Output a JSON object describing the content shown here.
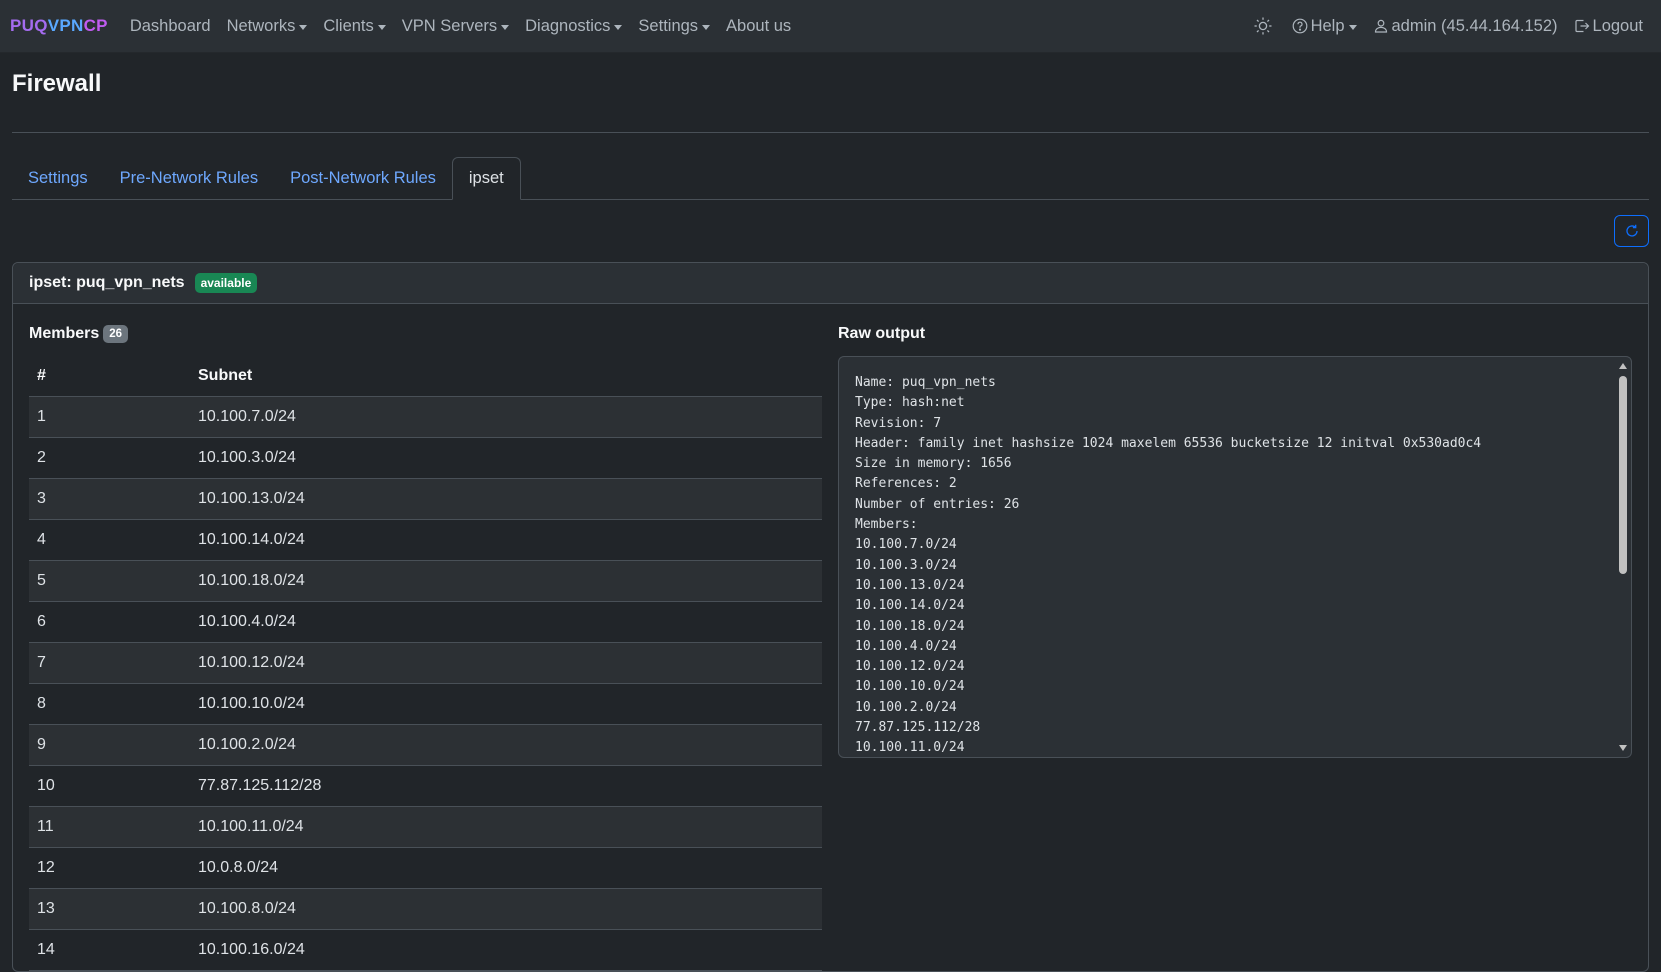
{
  "navbar": {
    "brand": {
      "part1": "PUQ",
      "part2": "VPN",
      "part3": "CP"
    },
    "items": [
      {
        "label": "Dashboard",
        "dropdown": false
      },
      {
        "label": "Networks",
        "dropdown": true
      },
      {
        "label": "Clients",
        "dropdown": true
      },
      {
        "label": "VPN Servers",
        "dropdown": true
      },
      {
        "label": "Diagnostics",
        "dropdown": true
      },
      {
        "label": "Settings",
        "dropdown": true
      },
      {
        "label": "About us",
        "dropdown": false
      }
    ],
    "theme_icon": "sun-icon",
    "help_label": "Help",
    "user_label": "admin (45.44.164.152)",
    "logout_label": "Logout"
  },
  "page": {
    "title": "Firewall",
    "tabs": [
      {
        "label": "Settings",
        "active": false
      },
      {
        "label": "Pre-Network Rules",
        "active": false
      },
      {
        "label": "Post-Network Rules",
        "active": false
      },
      {
        "label": "ipset",
        "active": true
      }
    ]
  },
  "ipset": {
    "title": "ipset: puq_vpn_nets",
    "status": "available",
    "members_label": "Members",
    "members_count": "26",
    "table_headers": [
      "#",
      "Subnet"
    ],
    "rows": [
      [
        "1",
        "10.100.7.0/24"
      ],
      [
        "2",
        "10.100.3.0/24"
      ],
      [
        "3",
        "10.100.13.0/24"
      ],
      [
        "4",
        "10.100.14.0/24"
      ],
      [
        "5",
        "10.100.18.0/24"
      ],
      [
        "6",
        "10.100.4.0/24"
      ],
      [
        "7",
        "10.100.12.0/24"
      ],
      [
        "8",
        "10.100.10.0/24"
      ],
      [
        "9",
        "10.100.2.0/24"
      ],
      [
        "10",
        "77.87.125.112/28"
      ],
      [
        "11",
        "10.100.11.0/24"
      ],
      [
        "12",
        "10.0.8.0/24"
      ],
      [
        "13",
        "10.100.8.0/24"
      ],
      [
        "14",
        "10.100.16.0/24"
      ]
    ],
    "raw_label": "Raw output",
    "raw_output": "Name: puq_vpn_nets\nType: hash:net\nRevision: 7\nHeader: family inet hashsize 1024 maxelem 65536 bucketsize 12 initval 0x530ad0c4\nSize in memory: 1656\nReferences: 2\nNumber of entries: 26\nMembers:\n10.100.7.0/24\n10.100.3.0/24\n10.100.13.0/24\n10.100.14.0/24\n10.100.18.0/24\n10.100.4.0/24\n10.100.12.0/24\n10.100.10.0/24\n10.100.2.0/24\n77.87.125.112/28\n10.100.11.0/24"
  }
}
